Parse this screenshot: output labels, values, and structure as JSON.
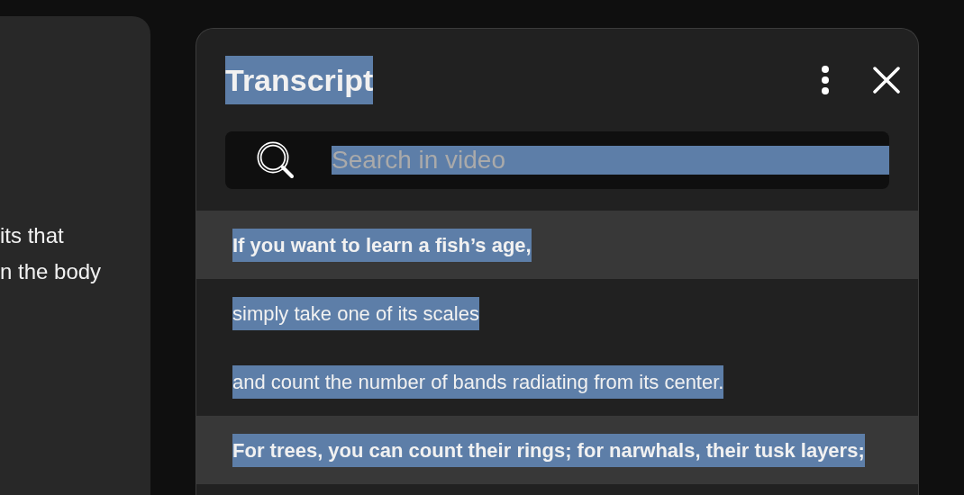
{
  "side_card": {
    "lines": [
      "its that",
      "n the body"
    ]
  },
  "panel": {
    "title": "Transcript",
    "text_selected": true
  },
  "search": {
    "placeholder": "Search in video"
  },
  "segments": [
    {
      "text": "If you want to learn a fish’s age,",
      "selected": true
    },
    {
      "text": "simply take one of its scales",
      "selected": false
    },
    {
      "text": "and count the number of bands radiating from its center.",
      "selected": false
    },
    {
      "text": "For trees, you can count their rings; for narwhals, their tusk layers;",
      "selected": true
    }
  ]
}
